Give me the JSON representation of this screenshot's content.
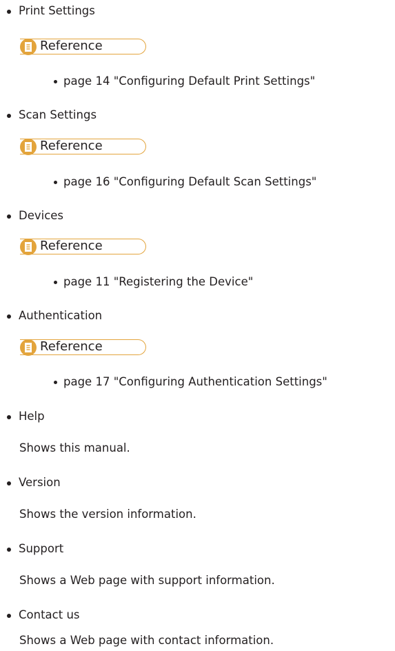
{
  "items": [
    {
      "label": "Print Settings",
      "reference_label": "Reference",
      "link": "page 14 \"Configuring Default Print Settings\""
    },
    {
      "label": "Scan Settings",
      "reference_label": "Reference",
      "link": "page 16 \"Configuring Default Scan Settings\""
    },
    {
      "label": "Devices",
      "reference_label": "Reference",
      "link": "page 11 \"Registering the Device\""
    },
    {
      "label": "Authentication",
      "reference_label": "Reference",
      "link": "page 17 \"Configuring Authentication Settings\""
    },
    {
      "label": "Help",
      "description": "Shows this manual."
    },
    {
      "label": "Version",
      "description": "Shows the version information."
    },
    {
      "label": "Support",
      "description": "Shows a Web page with support information."
    },
    {
      "label": "Contact us",
      "description": "Shows a Web page with contact information."
    }
  ],
  "colors": {
    "text": "#231f20",
    "reference_accent": "#e3a43c"
  },
  "icons": {
    "reference": "reference-document-icon",
    "bullet": "bullet-dot"
  }
}
